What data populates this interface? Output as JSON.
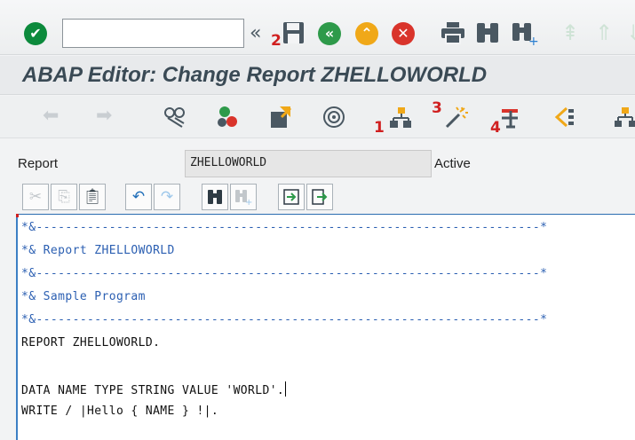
{
  "system_toolbar": {
    "command_field_value": "",
    "icons": {
      "enter": "check-icon",
      "history": "double-chevron-left-icon",
      "save": "save-icon",
      "back": "back-icon",
      "exit": "exit-icon",
      "cancel": "cancel-icon",
      "print": "print-icon",
      "find": "find-icon",
      "find_next": "find-next-icon"
    },
    "colors": {
      "enter": "#0c8a3c",
      "back": "#2e9a4a",
      "exit": "#f0a818",
      "cancel": "#d9342b"
    }
  },
  "title": "ABAP Editor: Change Report ZHELLOWORLD",
  "app_toolbar": {
    "icons": [
      "back-arrow-icon",
      "forward-arrow-icon",
      "display-change-icon",
      "activate-icon",
      "check-object-icon",
      "test-icon",
      "where-used-icon",
      "pattern-icon",
      "pretty-printer-icon",
      "navigation-icon",
      "object-list-icon"
    ]
  },
  "annotations": [
    "1",
    "2",
    "3",
    "4"
  ],
  "header": {
    "report_label": "Report",
    "report_value": "ZHELLOWORLD",
    "status": "Active"
  },
  "editor_toolbar": {
    "icons": [
      "cut-icon",
      "copy-icon",
      "paste-icon",
      "undo-icon",
      "redo-icon",
      "find-icon",
      "find-next-icon",
      "insert-block-icon",
      "move-block-icon"
    ]
  },
  "code": {
    "lines": [
      "*&---------------------------------------------------------------------*",
      "*& Report ZHELLOWORLD",
      "*&---------------------------------------------------------------------*",
      "*& Sample Program",
      "*&---------------------------------------------------------------------*",
      "REPORT ZHELLOWORLD.",
      "",
      "DATA NAME TYPE STRING VALUE 'WORLD'.",
      "WRITE / |Hello { NAME } !|."
    ]
  }
}
